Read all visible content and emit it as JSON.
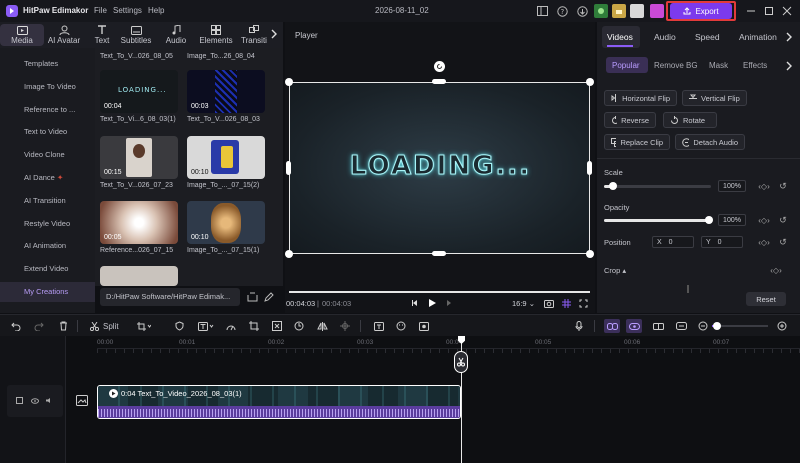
{
  "app": {
    "name": "HitPaw Edimakor",
    "menu": [
      "File",
      "Settings",
      "Help"
    ],
    "title": "2026-08-11_02",
    "export_label": "Export"
  },
  "media_tabs": [
    {
      "label": "Media",
      "icon": "media-icon"
    },
    {
      "label": "AI Avatar",
      "icon": "ai-avatar-icon"
    },
    {
      "label": "Text",
      "icon": "text-icon"
    },
    {
      "label": "Subtitles",
      "icon": "subtitles-icon"
    },
    {
      "label": "Audio",
      "icon": "audio-icon"
    },
    {
      "label": "Elements",
      "icon": "elements-icon"
    },
    {
      "label": "Transiti",
      "icon": "transition-icon"
    }
  ],
  "left_nav": [
    "Templates",
    "Image To Video",
    "Reference to ...",
    "Text to Video",
    "Video Clone",
    "AI Dance",
    "AI Transition",
    "Restyle Video",
    "AI Animation",
    "Extend Video",
    "My Creations"
  ],
  "media_items": [
    {
      "name": "Text_To_V...026_08_05",
      "duration": ""
    },
    {
      "name": "Image_To...26_08_04",
      "duration": ""
    },
    {
      "name": "Text_To_Vi...6_08_03(1)",
      "duration": "00:04"
    },
    {
      "name": "Text_To_V...026_08_03",
      "duration": "00:03"
    },
    {
      "name": "Text_To_V...026_07_23",
      "duration": "00:15"
    },
    {
      "name": "Image_To_..._07_15(2)",
      "duration": "00:10"
    },
    {
      "name": "Reference...026_07_15",
      "duration": "00:05"
    },
    {
      "name": "Image_To_..._07_15(1)",
      "duration": "00:10"
    }
  ],
  "path": "D:/HitPaw Software/HitPaw Edimak...",
  "player": {
    "label": "Player",
    "preview_text": "LOADING...",
    "current_time": "00:04:03",
    "total_time": "00:04:03",
    "ratio": "16:9",
    "progress": 1.0
  },
  "right": {
    "tabs": [
      "Videos",
      "Audio",
      "Speed",
      "Animation"
    ],
    "subtabs": [
      "Popular",
      "Remove BG",
      "Mask",
      "Effects"
    ],
    "buttons": [
      "Horizontal Flip",
      "Vertical Flip",
      "Reverse",
      "Rotate",
      "Replace Clip",
      "Detach Audio"
    ],
    "scale_label": "Scale",
    "scale_value": "100%",
    "scale_level": 0.08,
    "opacity_label": "Opacity",
    "opacity_value": "100%",
    "opacity_level": 1.0,
    "position_label": "Position",
    "pos_x_label": "X",
    "pos_x": "0",
    "pos_y_label": "Y",
    "pos_y": "0",
    "crop_label": "Crop",
    "reset_label": "Reset"
  },
  "toolbar": {
    "split_label": "Split"
  },
  "timeline": {
    "ticks": [
      "00:00",
      "00:01",
      "00:02",
      "00:03",
      "00:04",
      "00:05",
      "00:06",
      "00:07"
    ],
    "clip_label": "0:04 Text_To_Video_2026_08_03(1)"
  },
  "colors": {
    "accent": "#8b5cf6",
    "export_bg": "#7c3aed",
    "highlight_border": "#e23b3b"
  }
}
